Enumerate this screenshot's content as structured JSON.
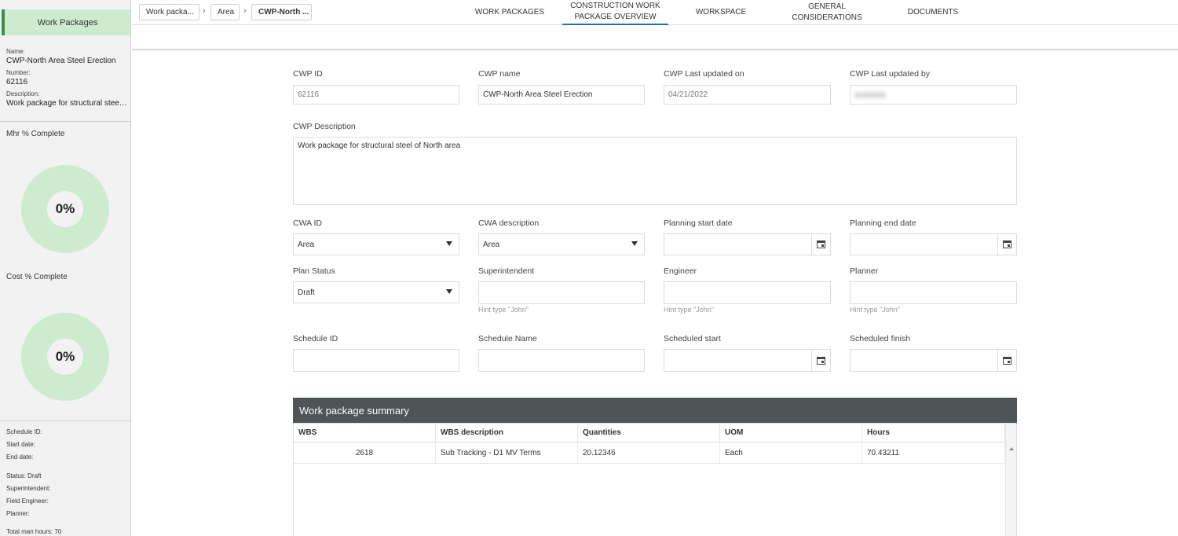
{
  "sidebar": {
    "tab_label": "Work Packages",
    "name_label": "Name:",
    "name_value": "CWP-North Area Steel Erection",
    "number_label": "Number:",
    "number_value": "62116",
    "description_label": "Description:",
    "description_value": "Work package for structural steel …",
    "mhr_title": "Mhr % Complete",
    "mhr_value": "0%",
    "mhr_fraction": 0,
    "cost_title": "Cost % Complete",
    "cost_value": "0%",
    "cost_fraction": 0,
    "schedule_id": "Schedule ID:",
    "start_date": "Start date:",
    "end_date": "End date:",
    "status": "Status: Draft",
    "superintendent": "Superintendent:",
    "field_engineer": "Field Engineer:",
    "planner": "Planner:",
    "total_man_hours": "Total man hours: 70"
  },
  "breadcrumb": {
    "item1": "Work packa...",
    "sep": "›",
    "item2": "Area",
    "item3": "CWP-North ..."
  },
  "nav": {
    "tab1": "WORK PACKAGES",
    "tab2_line1": "CONSTRUCTION WORK",
    "tab2_line2": "PACKAGE OVERVIEW",
    "tab3": "WORKSPACE",
    "tab4_line1": "GENERAL",
    "tab4_line2": "CONSIDERATIONS",
    "tab5": "DOCUMENTS"
  },
  "form": {
    "cwp_id_label": "CWP ID",
    "cwp_id_value": "62116",
    "cwp_name_label": "CWP name",
    "cwp_name_value": "CWP-North Area Steel Erection",
    "updated_on_label": "CWP Last updated on",
    "updated_on_value": "04/21/2022",
    "updated_by_label": "CWP Last updated by",
    "description_label": "CWP Description",
    "description_value": "Work package for structural steel of North area",
    "cwa_id_label": "CWA ID",
    "cwa_id_value": "Area",
    "cwa_desc_label": "CWA description",
    "cwa_desc_value": "Area",
    "plan_start_label": "Planning start date",
    "plan_end_label": "Planning end date",
    "plan_status_label": "Plan Status",
    "plan_status_value": "Draft",
    "superintendent_label": "Superintendent",
    "engineer_label": "Engineer",
    "planner_label": "Planner",
    "hint": "Hint type \"John\"",
    "schedule_id_label": "Schedule ID",
    "schedule_name_label": "Schedule Name",
    "scheduled_start_label": "Scheduled start",
    "scheduled_finish_label": "Scheduled finish"
  },
  "summary": {
    "title": "Work package summary",
    "columns": [
      "WBS",
      "WBS description",
      "Quantities",
      "UOM",
      "Hours"
    ],
    "rows": [
      [
        "2618",
        "Sub Tracking - D1 MV Terms",
        "20.12346",
        "Each",
        "70.43211"
      ]
    ]
  },
  "colors": {
    "accent_green": "#cdeccf",
    "active_tab": "#2a6fb0",
    "summary_header": "#4f5456"
  }
}
